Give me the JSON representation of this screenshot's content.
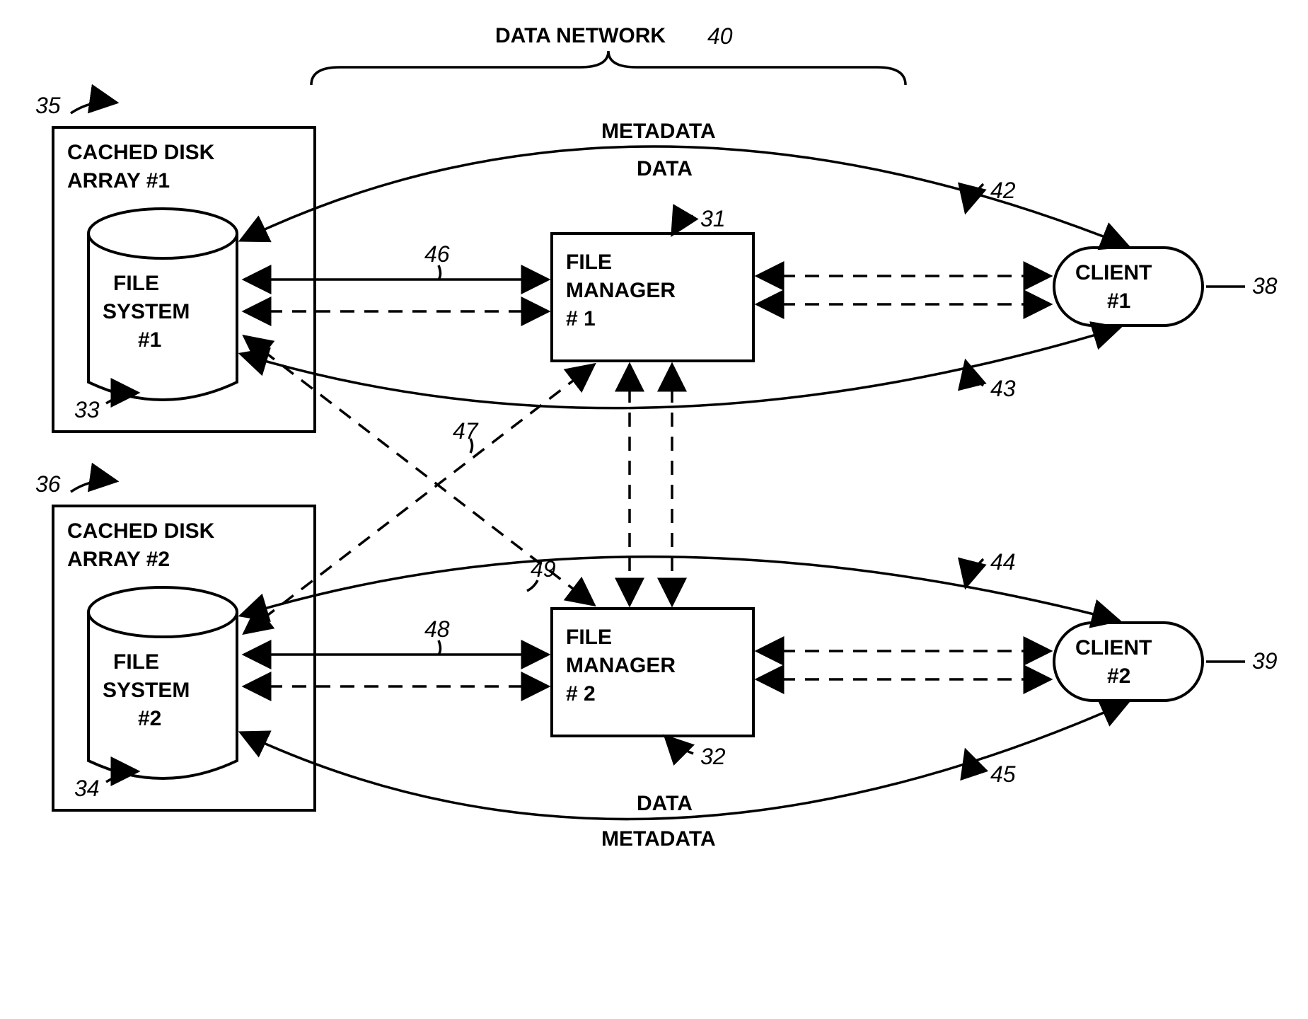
{
  "title": "DATA NETWORK",
  "title_ref": "40",
  "disk_array_1": {
    "label": "CACHED DISK ARRAY #1",
    "ref": "35"
  },
  "disk_array_2": {
    "label": "CACHED DISK ARRAY #2",
    "ref": "36"
  },
  "file_system_1": {
    "label": "FILE SYSTEM #1",
    "ref": "33"
  },
  "file_system_2": {
    "label": "FILE SYSTEM #2",
    "ref": "34"
  },
  "file_manager_1": {
    "label": "FILE MANAGER # 1",
    "ref": "31"
  },
  "file_manager_2": {
    "label": "FILE MANAGER # 2",
    "ref": "32"
  },
  "client_1": {
    "label": "CLIENT #1",
    "ref": "38"
  },
  "client_2": {
    "label": "CLIENT #2",
    "ref": "39"
  },
  "metadata_top": "METADATA",
  "data_top": "DATA",
  "metadata_bottom": "METADATA",
  "data_bottom": "DATA",
  "arc_refs": {
    "top_outer": "42",
    "top_inner": "43",
    "bottom_outer": "45",
    "bottom_inner": "44"
  },
  "conn_refs": {
    "fm1_fs1_solid": "46",
    "fm1_fs2_solid": "47",
    "fm2_fs2_solid": "48",
    "fm2_fs1_solid": "49"
  }
}
